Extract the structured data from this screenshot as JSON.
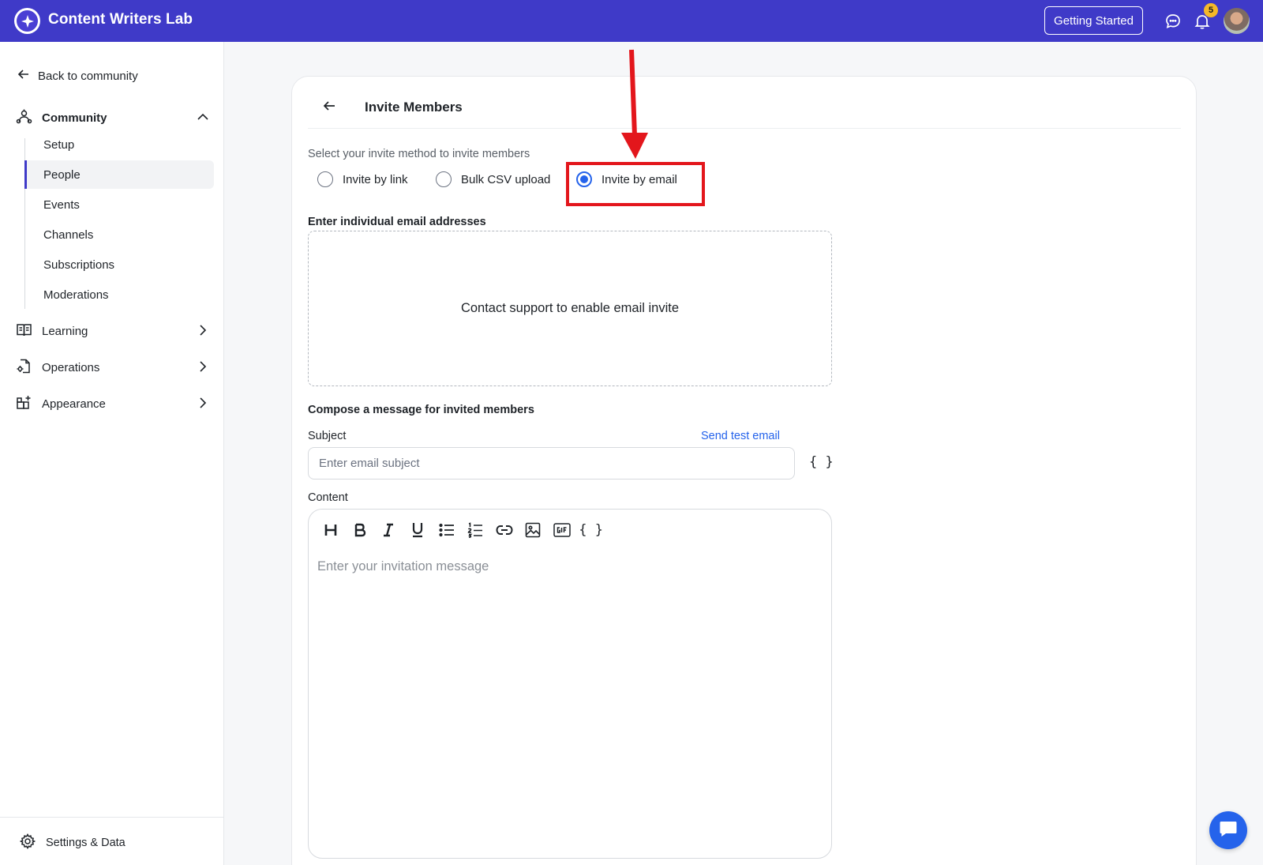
{
  "app": {
    "title": "Content Writers Lab"
  },
  "topbar": {
    "getting_started_label": "Getting Started",
    "notification_count": "5"
  },
  "sidebar": {
    "back_label": "Back to community",
    "community": {
      "label": "Community",
      "items": [
        {
          "label": "Setup"
        },
        {
          "label": "People",
          "active": true
        },
        {
          "label": "Events"
        },
        {
          "label": "Channels"
        },
        {
          "label": "Subscriptions"
        },
        {
          "label": "Moderations"
        }
      ]
    },
    "sections": [
      {
        "label": "Learning",
        "icon": "book-icon"
      },
      {
        "label": "Operations",
        "icon": "document-cog-icon"
      },
      {
        "label": "Appearance",
        "icon": "layout-add-icon"
      }
    ],
    "settings_label": "Settings & Data"
  },
  "invite": {
    "title": "Invite Members",
    "method_prompt": "Select your invite method to invite members",
    "methods": [
      {
        "label": "Invite by link",
        "checked": false
      },
      {
        "label": "Bulk CSV upload",
        "checked": false
      },
      {
        "label": "Invite by email",
        "checked": true
      }
    ],
    "email_section_label": "Enter individual email addresses",
    "email_box_message": "Contact support to enable email invite",
    "compose_label": "Compose a message for invited members",
    "subject_label": "Subject",
    "send_test_label": "Send test email",
    "subject_placeholder": "Enter email subject",
    "variables_label": "{ }",
    "content_label": "Content",
    "content_placeholder": "Enter your invitation message"
  },
  "colors": {
    "brand": "#3f3ac8",
    "accent": "#2563eb",
    "highlight": "#e3161c",
    "badge": "#f5b829"
  }
}
